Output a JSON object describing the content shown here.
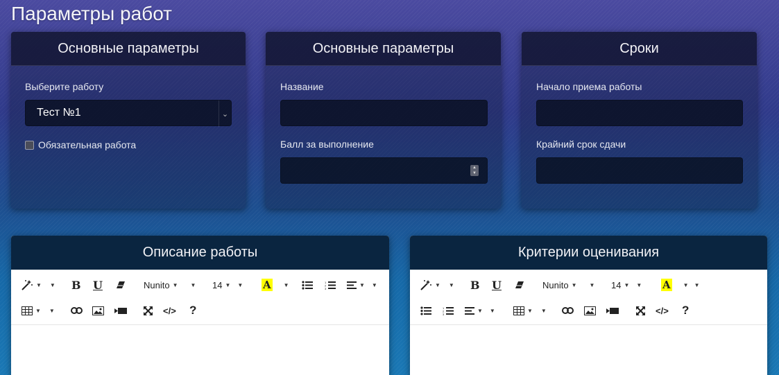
{
  "page": {
    "title": "Параметры работ"
  },
  "cards": {
    "main_params": {
      "title": "Основные параметры",
      "select_label": "Выберите работу",
      "select_value": "Тест №1",
      "checkbox_label": "Обязательная работа"
    },
    "main_params2": {
      "title": "Основные параметры",
      "name_label": "Название",
      "name_value": "",
      "score_label": "Балл за выполнение",
      "score_value": ""
    },
    "deadlines": {
      "title": "Сроки",
      "start_label": "Начало приема работы",
      "start_value": "",
      "deadline_label": "Крайний срок сдачи",
      "deadline_value": ""
    }
  },
  "editors": {
    "description": {
      "title": "Описание работы"
    },
    "criteria": {
      "title": "Критерии оценивания"
    },
    "font_name": "Nunito",
    "font_size": "14",
    "bold_glyph": "B",
    "underline_glyph": "U",
    "color_glyph": "A",
    "code_glyph": "</>",
    "help_glyph": "?"
  }
}
